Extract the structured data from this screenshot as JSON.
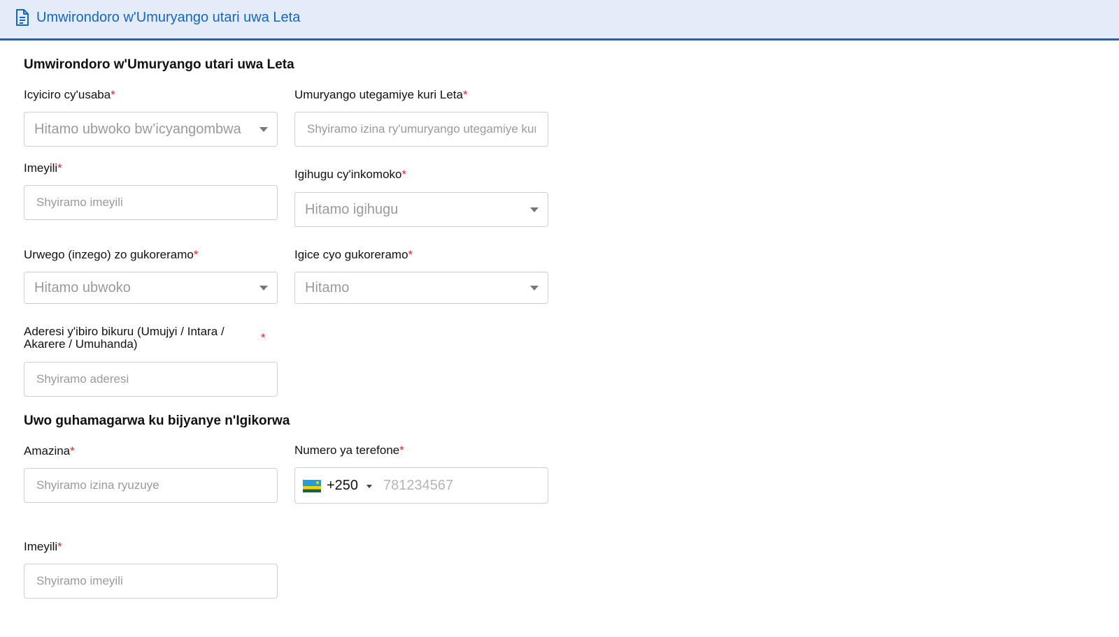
{
  "header": {
    "title": "Umwirondoro w'Umuryango utari uwa Leta"
  },
  "section1": {
    "title": "Umwirondoro w'Umuryango utari uwa Leta",
    "applicant_category": {
      "label": "Icyiciro cy'usaba",
      "placeholder": "Hitamo ubwoko bw’icyangombwa"
    },
    "parent_org": {
      "label": "Umuryango utegamiye kuri Leta",
      "placeholder": "Shyiramo izina ry'umuryango utegamiye kuri Leta"
    },
    "email": {
      "label": "Imeyili",
      "placeholder": "Shyiramo imeyili"
    },
    "country": {
      "label": "Igihugu cy'inkomoko",
      "placeholder": "Hitamo igihugu"
    },
    "sector": {
      "label": "Urwego (inzego) zo gukoreramo",
      "placeholder": "Hitamo ubwoko"
    },
    "area": {
      "label": "Igice cyo gukoreramo",
      "placeholder": "Hitamo"
    },
    "address": {
      "label_line1": "Aderesi y'ibiro bikuru (Umujyi / Intara /",
      "label_line2": "Akarere / Umuhanda)",
      "placeholder": "Shyiramo aderesi"
    }
  },
  "section2": {
    "title": "Uwo guhamagarwa ku bijyanye n'Igikorwa",
    "name": {
      "label": "Amazina",
      "placeholder": "Shyiramo izina ryuzuye"
    },
    "phone": {
      "label": "Numero ya terefone",
      "country_code": "+250",
      "placeholder": "781234567"
    },
    "email": {
      "label": "Imeyili",
      "placeholder": "Shyiramo imeyili"
    }
  },
  "required_marker": "*",
  "colors": {
    "accent": "#1665c0",
    "header_bg": "#e3ecf8",
    "required": "#e02424"
  },
  "icons": {
    "header": "document-icon",
    "dropdown": "caret-down-icon",
    "flag": "rwanda-flag-icon"
  }
}
